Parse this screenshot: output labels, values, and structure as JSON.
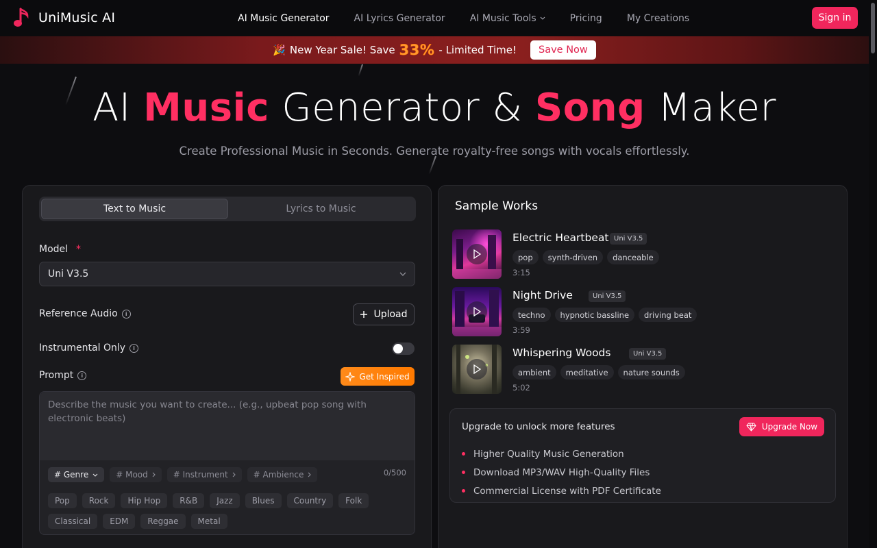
{
  "nav": {
    "brand": "UniMusic AI",
    "links": [
      "AI Music Generator",
      "AI Lyrics Generator",
      "AI Music Tools",
      "Pricing",
      "My Creations"
    ],
    "signin": "Sign in"
  },
  "promo": {
    "emoji": "🎉",
    "lead": "New Year Sale! Save",
    "percent": "33%",
    "tail": "- Limited Time!",
    "cta": "Save Now"
  },
  "hero": {
    "title_a": "AI ",
    "title_b": "Music",
    "title_c": " Generator & ",
    "title_d": "Song",
    "title_e": " Maker",
    "subtitle": "Create Professional Music in Seconds. Generate royalty-free songs with vocals effortlessly."
  },
  "form": {
    "tabs": [
      "Text to Music",
      "Lyrics to Music"
    ],
    "model_label": "Model",
    "model_required": "*",
    "model_value": "Uni V3.5",
    "reference_label": "Reference Audio",
    "upload": "Upload",
    "instrumental_label": "Instrumental Only",
    "prompt_label": "Prompt",
    "inspire": "Get Inspired",
    "prompt_placeholder": "Describe the music you want to create... (e.g., upbeat pop song with electronic beats)",
    "tag_tabs": [
      "# Genre",
      "# Mood",
      "# Instrument",
      "# Ambience"
    ],
    "counter": "0/500",
    "genres": [
      "Pop",
      "Rock",
      "Hip Hop",
      "R&B",
      "Jazz",
      "Blues",
      "Country",
      "Folk",
      "Classical",
      "EDM",
      "Reggae",
      "Metal"
    ]
  },
  "samples": {
    "title": "Sample Works",
    "tracks": [
      {
        "name": "Electric Heartbeat",
        "badge": "Uni V3.5",
        "tags": [
          "pop",
          "synth-driven",
          "danceable"
        ],
        "duration": "3:15"
      },
      {
        "name": "Night Drive",
        "badge": "Uni V3.5",
        "tags": [
          "techno",
          "hypnotic bassline",
          "driving beat"
        ],
        "duration": "3:59"
      },
      {
        "name": "Whispering Woods",
        "badge": "Uni V3.5",
        "tags": [
          "ambient",
          "meditative",
          "nature sounds"
        ],
        "duration": "5:02"
      }
    ]
  },
  "upgrade": {
    "title": "Upgrade to unlock more features",
    "cta": "Upgrade Now",
    "features": [
      "Higher Quality Music Generation",
      "Download MP3/WAV High-Quality Files",
      "Commercial License with PDF Certificate"
    ]
  },
  "colors": {
    "accent": "#f0265c",
    "orange": "#ff8a1a",
    "bg": "#0d0d10",
    "panel": "#19191c"
  }
}
